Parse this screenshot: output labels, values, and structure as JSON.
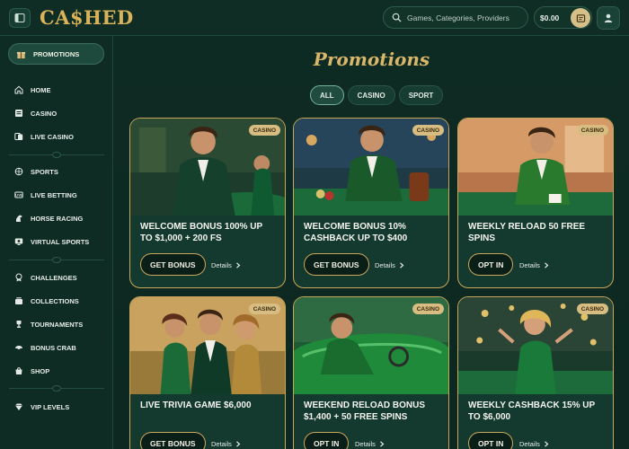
{
  "header": {
    "logo": "CA$HED",
    "search_placeholder": "Games, Categories, Providers",
    "balance": "$0.00"
  },
  "sidebar": {
    "promotions": "PROMOTIONS",
    "items": [
      {
        "label": "HOME",
        "icon": "home-icon"
      },
      {
        "label": "CASINO",
        "icon": "casino-icon"
      },
      {
        "label": "LIVE CASINO",
        "icon": "live-casino-icon"
      },
      {
        "label": "SPORTS",
        "icon": "sports-icon"
      },
      {
        "label": "LIVE BETTING",
        "icon": "live-betting-icon"
      },
      {
        "label": "HORSE RACING",
        "icon": "horse-icon"
      },
      {
        "label": "VIRTUAL SPORTS",
        "icon": "virtual-sports-icon"
      },
      {
        "label": "CHALLENGES",
        "icon": "challenges-icon"
      },
      {
        "label": "COLLECTIONS",
        "icon": "collections-icon"
      },
      {
        "label": "TOURNAMENTS",
        "icon": "trophy-icon"
      },
      {
        "label": "BONUS CRAB",
        "icon": "crab-icon"
      },
      {
        "label": "SHOP",
        "icon": "shop-icon"
      },
      {
        "label": "VIP LEVELS",
        "icon": "diamond-icon"
      }
    ]
  },
  "main": {
    "title": "Promotions",
    "filters": [
      "ALL",
      "CASINO",
      "SPORT"
    ],
    "details_label": "Details",
    "cards": [
      {
        "tag": "CASINO",
        "title": "WELCOME BONUS 100% UP TO $1,000 + 200 FS",
        "cta": "GET BONUS"
      },
      {
        "tag": "CASINO",
        "title": "WELCOME BONUS 10% CASHBACK UP TO $400",
        "cta": "GET BONUS"
      },
      {
        "tag": "CASINO",
        "title": "WEEKLY RELOAD 50 FREE SPINS",
        "cta": "OPT IN"
      },
      {
        "tag": "CASINO",
        "title": "LIVE TRIVIA GAME $6,000",
        "cta": "GET BONUS"
      },
      {
        "tag": "CASINO",
        "title": "WEEKEND RELOAD BONUS $1,400 + 50 FREE SPINS",
        "cta": "OPT IN"
      },
      {
        "tag": "CASINO",
        "title": "WEEKLY CASHBACK 15% UP TO $6,000",
        "cta": "OPT IN"
      }
    ]
  },
  "colors": {
    "background": "#0d2a22",
    "gold": "#c9a75a",
    "accent_green": "#1f4c3f"
  }
}
